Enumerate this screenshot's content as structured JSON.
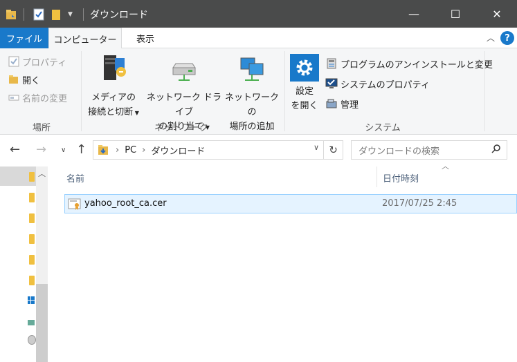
{
  "window": {
    "title": "ダウンロード",
    "minimize": "—",
    "maximize": "☐",
    "close": "✕"
  },
  "ribbon_tabs": {
    "file": "ファイル",
    "computer": "コンピューター",
    "view": "表示",
    "help": "?"
  },
  "ribbon": {
    "location": {
      "properties": "プロパティ",
      "open": "開く",
      "rename": "名前の変更",
      "label": "場所"
    },
    "network": {
      "media_line1": "メディアの",
      "media_line2": "接続と切断",
      "map_drive_line1": "ネットワーク ドライブ",
      "map_drive_line2": "の割り当て",
      "add_location_line1": "ネットワークの",
      "add_location_line2": "場所の追加",
      "label": "ネットワーク"
    },
    "system": {
      "settings_line1": "設定",
      "settings_line2": "を開く",
      "uninstall": "プログラムのアンインストールと変更",
      "system_properties": "システムのプロパティ",
      "manage": "管理",
      "label": "システム"
    }
  },
  "navigation": {
    "breadcrumb": [
      "PC",
      "ダウンロード"
    ],
    "search_placeholder": "ダウンロードの検索"
  },
  "file_list": {
    "columns": [
      "名前",
      "日付時刻"
    ],
    "rows": [
      {
        "name": "yahoo_root_ca.cer",
        "date": "2017/07/25 2:45"
      }
    ]
  },
  "colors": {
    "accent": "#1979ca",
    "titlebar": "#4a4b4b",
    "selection": "#e5f3ff"
  }
}
